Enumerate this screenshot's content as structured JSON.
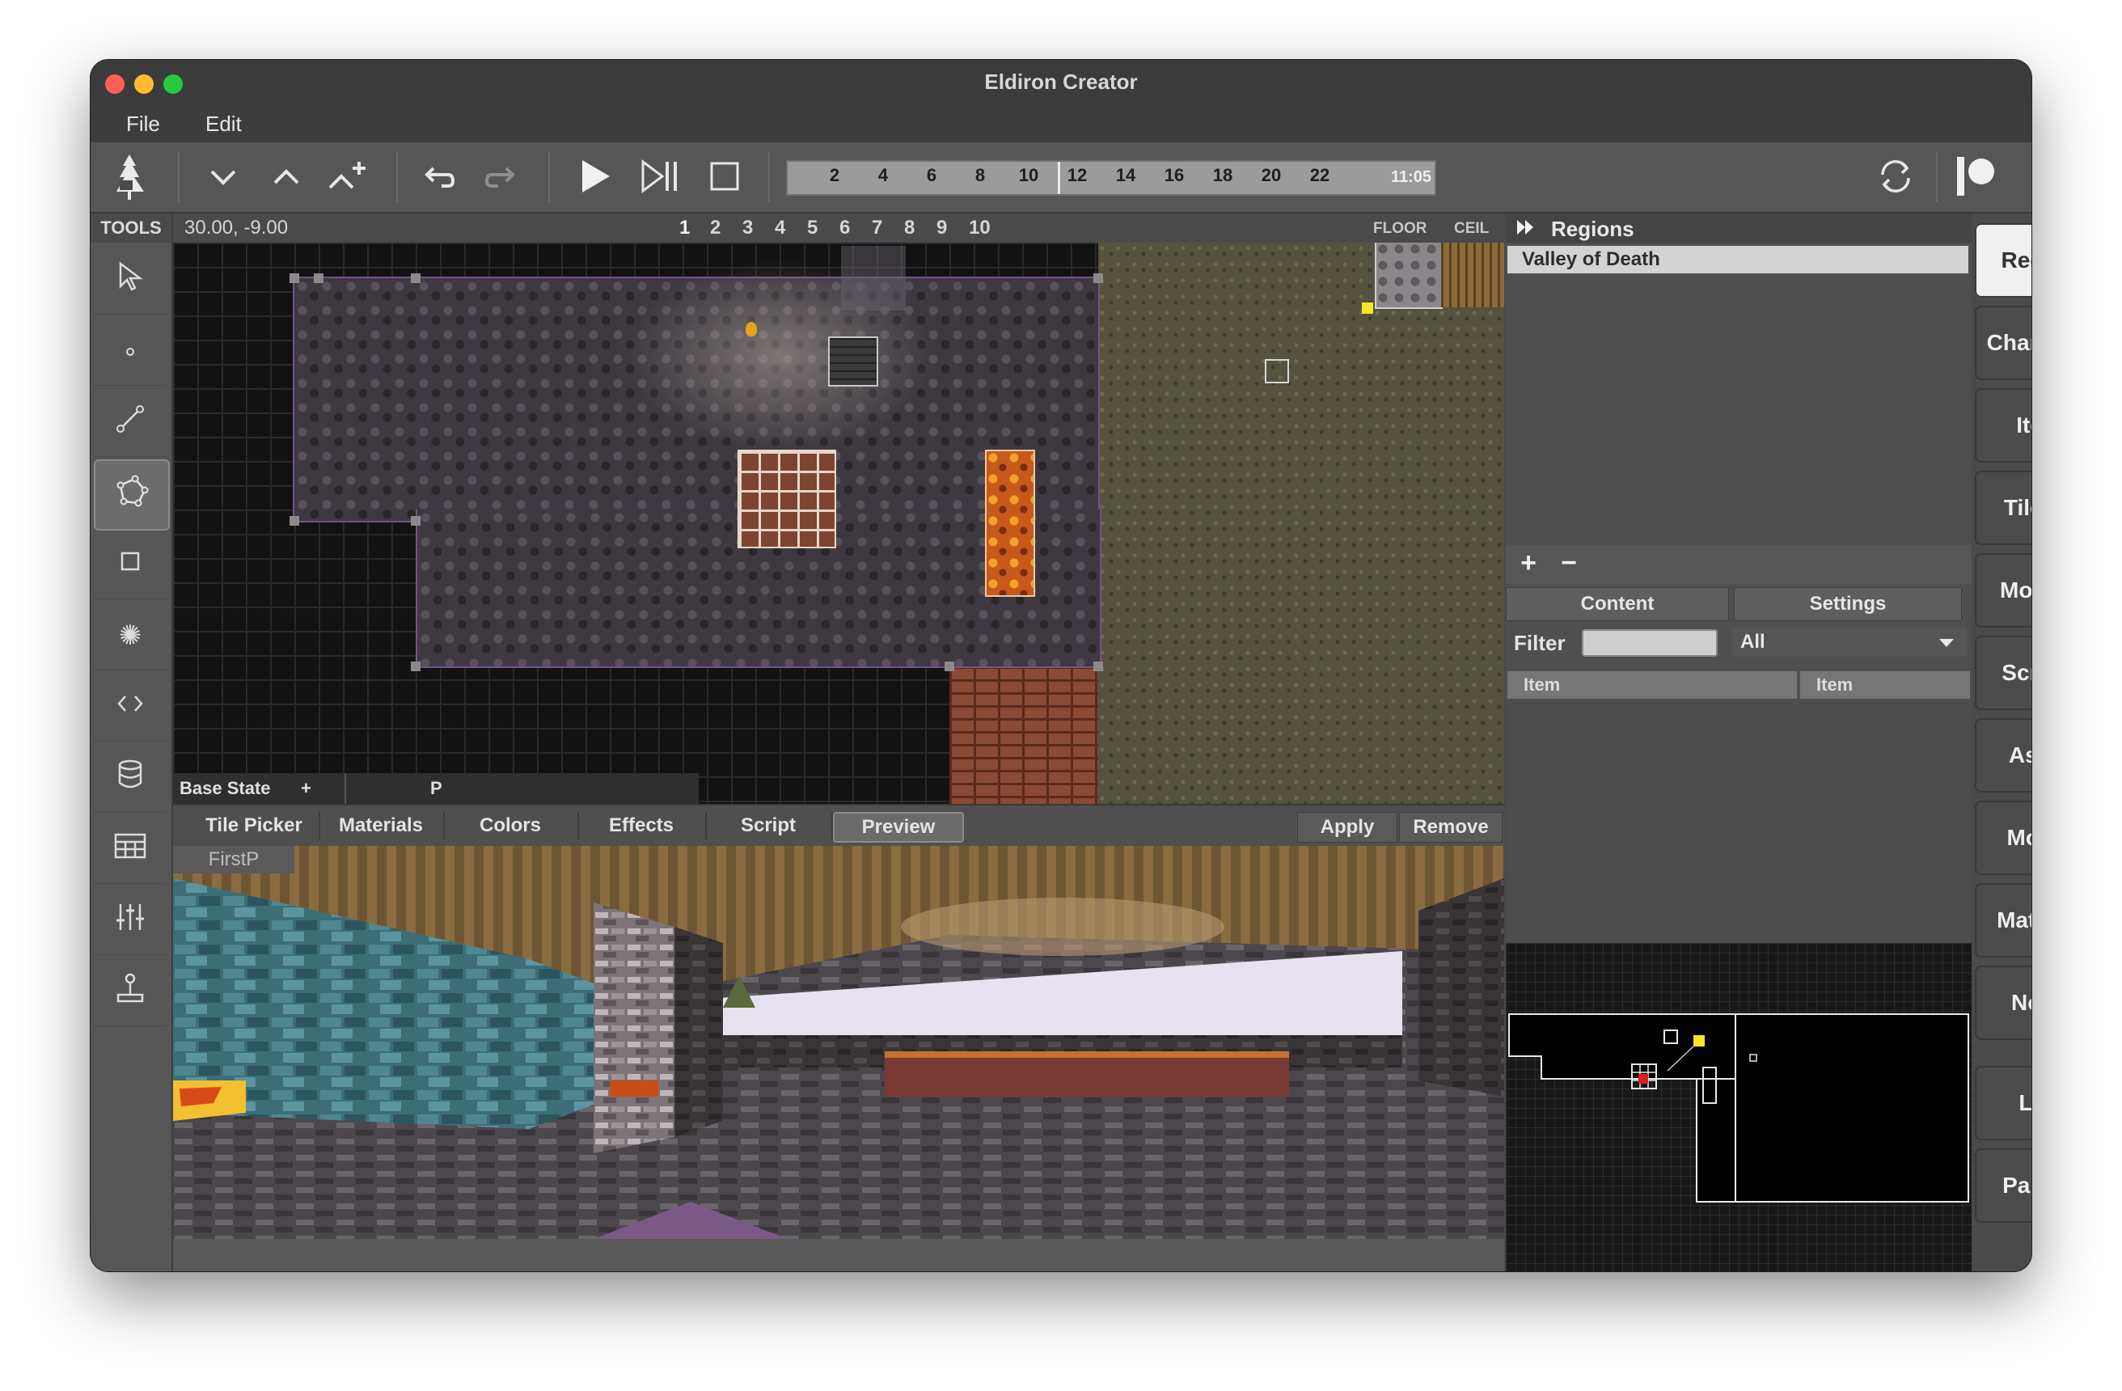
{
  "window": {
    "title": "Eldiron Creator"
  },
  "menu": {
    "file": "File",
    "edit": "Edit"
  },
  "timeline": {
    "ticks": [
      "2",
      "4",
      "6",
      "8",
      "10",
      "12",
      "14",
      "16",
      "18",
      "20",
      "22"
    ],
    "time": "11:05"
  },
  "tools": {
    "header": "TOOLS",
    "items": [
      {
        "name": "selection-tool-icon",
        "glyph": "⬉"
      },
      {
        "name": "vertex-tool-icon",
        "glyph": "∘"
      },
      {
        "name": "linedef-tool-icon",
        "glyph": "⟋"
      },
      {
        "name": "sector-tool-icon",
        "glyph": "⬠"
      },
      {
        "name": "rect-tool-icon",
        "glyph": "□"
      },
      {
        "name": "effect-tool-icon",
        "glyph": "✺"
      },
      {
        "name": "code-tool-icon",
        "glyph": "‹›"
      },
      {
        "name": "data-tool-icon",
        "glyph": "⛁"
      },
      {
        "name": "tileset-tool-icon",
        "glyph": "▦"
      },
      {
        "name": "settings-tool-icon",
        "glyph": "⫶"
      },
      {
        "name": "game-tool-icon",
        "glyph": "⚲"
      }
    ]
  },
  "map": {
    "coords": "30.00, -9.00",
    "layers": [
      "1",
      "2",
      "3",
      "4",
      "5",
      "6",
      "7",
      "8",
      "9",
      "10"
    ],
    "floor_label": "FLOOR",
    "ceil_label": "CEIL",
    "base_state": "Base State",
    "add_state": "+",
    "p_label": "P"
  },
  "tabs": {
    "tile_picker": "Tile Picker",
    "materials": "Materials",
    "colors": "Colors",
    "effects": "Effects",
    "script": "Script",
    "preview": "Preview",
    "apply": "Apply",
    "remove": "Remove"
  },
  "preview": {
    "label": "FirstP"
  },
  "regions": {
    "header": "Regions",
    "items": [
      "Valley of Death"
    ],
    "add": "+",
    "remove": "−",
    "content_tab": "Content",
    "settings_tab": "Settings",
    "filter_label": "Filter",
    "filter_value": "",
    "filter_select": "All",
    "col1": "Item",
    "col2": "Item"
  },
  "sidebar": {
    "region": "Region",
    "character": "Character",
    "item": "Item",
    "tileset": "Tileset",
    "module": "Module",
    "screen": "Screen",
    "asset": "Asset",
    "model": "Model",
    "material": "Material",
    "node": "Node",
    "log": "Log",
    "palette": "Palette"
  },
  "colors": {
    "accent_yellow": "#f5e62a",
    "sector_outline": "#7a4f8a",
    "active_sidebar": "#f0f0f0"
  }
}
